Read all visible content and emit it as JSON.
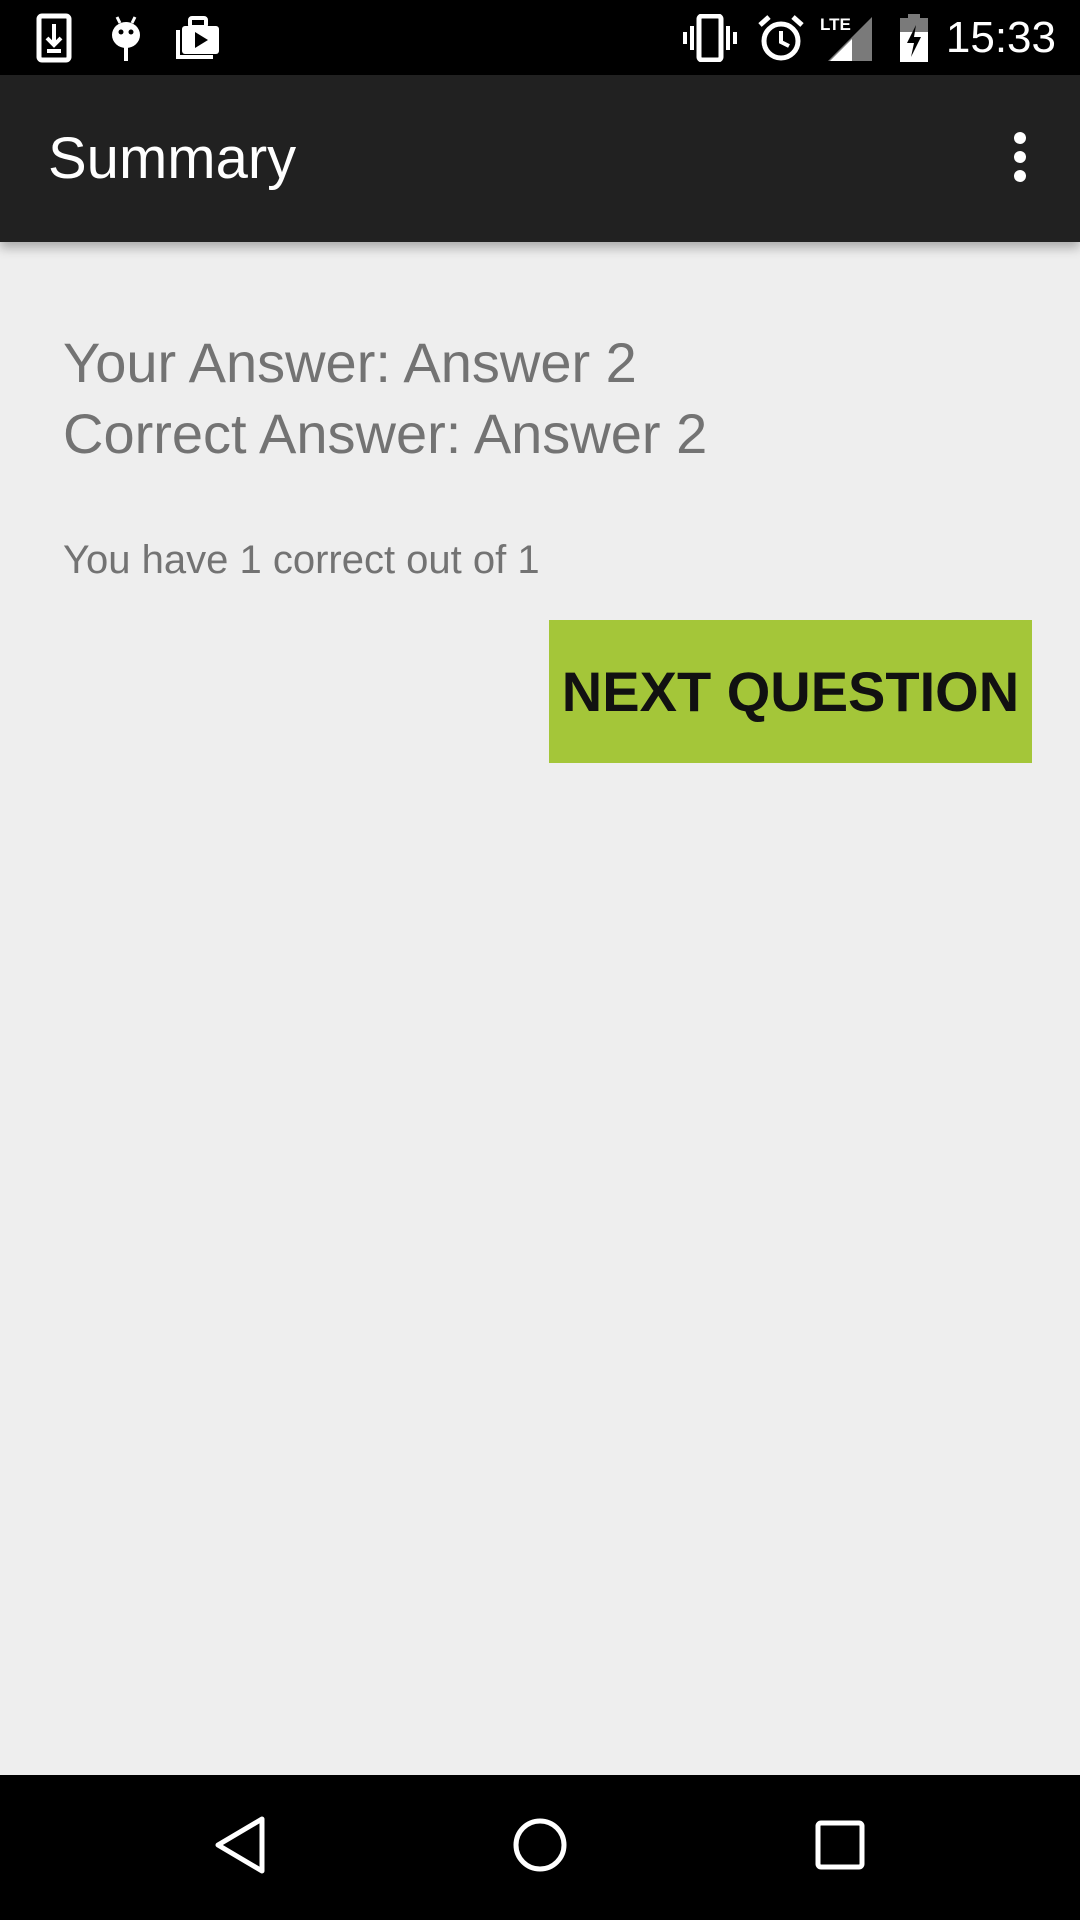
{
  "status_bar": {
    "time": "15:33",
    "left_icons": [
      "download-icon",
      "android-debug-icon",
      "play-store-icon"
    ],
    "right_icons": [
      "vibrate-icon",
      "alarm-icon",
      "lte-signal-icon",
      "battery-charging-icon"
    ],
    "network_label": "LTE"
  },
  "app_bar": {
    "title": "Summary",
    "overflow_icon": "more-vert-icon"
  },
  "summary": {
    "your_answer": "Your Answer: Answer 2",
    "correct_answer": "Correct Answer: Answer 2",
    "score": "You have 1 correct out of 1",
    "next_button_label": "NEXT QUESTION"
  },
  "nav_bar": {
    "icons": [
      "back-icon",
      "home-icon",
      "recents-icon"
    ]
  },
  "colors": {
    "status_bar": "#000000",
    "app_bar": "#212121",
    "background": "#eeeeee",
    "text_secondary": "#737373",
    "button_accent": "#a4c639"
  }
}
